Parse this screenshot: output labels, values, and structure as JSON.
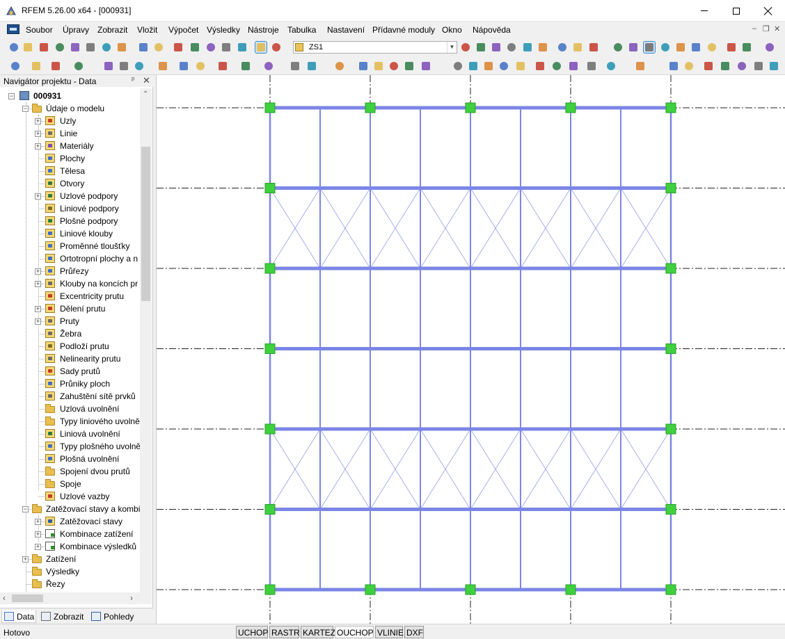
{
  "window": {
    "title": "RFEM 5.26.00 x64 - [000931]"
  },
  "menu": [
    {
      "label": "Soubor",
      "accel": "S",
      "rest": "oubor"
    },
    {
      "label": "Úpravy",
      "accel": "Ú",
      "rest": "pravy"
    },
    {
      "label": "Zobrazit",
      "accel": "Z",
      "rest": "obrazit"
    },
    {
      "label": "Vložit",
      "accel": "V",
      "rest": "ložit"
    },
    {
      "label": "Výpočet",
      "accel": "",
      "rest": "Výpočet"
    },
    {
      "label": "Výsledky",
      "accel": "",
      "rest": "Výsledky"
    },
    {
      "label": "Nástroje",
      "accel": "",
      "rest": "Nástroje"
    },
    {
      "label": "Tabulka",
      "accel": "T",
      "rest": "abulka"
    },
    {
      "label": "Nastavení",
      "accel": "",
      "rest": "Nastavení"
    },
    {
      "label": "Přídavné moduly",
      "accel": "",
      "rest": "Přídavné moduly"
    },
    {
      "label": "Okno",
      "accel": "O",
      "rest": "kno"
    },
    {
      "label": "Nápověda",
      "accel": "N",
      "rest": "ápověda"
    }
  ],
  "load_case": {
    "value": "ZS1"
  },
  "navigator": {
    "title": "Navigátor projektu - Data",
    "root": "000931",
    "tree": [
      {
        "label": "Údaje o modelu",
        "level": 1,
        "expander": "-",
        "icon": "folder"
      },
      {
        "label": "Uzly",
        "level": 2,
        "expander": "+",
        "icon": "item",
        "glyph": "#c43a2a"
      },
      {
        "label": "Linie",
        "level": 2,
        "expander": "+",
        "icon": "item",
        "glyph": "#6a6a6a"
      },
      {
        "label": "Materiály",
        "level": 2,
        "expander": "+",
        "icon": "item",
        "glyph": "#7a4ab5"
      },
      {
        "label": "Plochy",
        "level": 2,
        "expander": "",
        "icon": "item",
        "glyph": "#3e6fc4"
      },
      {
        "label": "Tělesa",
        "level": 2,
        "expander": "",
        "icon": "item",
        "glyph": "#3e6fc4"
      },
      {
        "label": "Otvory",
        "level": 2,
        "expander": "",
        "icon": "item",
        "glyph": "#2b7a45"
      },
      {
        "label": "Uzlové podpory",
        "level": 2,
        "expander": "+",
        "icon": "item",
        "glyph": "#2b7a45"
      },
      {
        "label": "Liniové podpory",
        "level": 2,
        "expander": "",
        "icon": "item",
        "glyph": "#7b6b2b"
      },
      {
        "label": "Plošné podpory",
        "level": 2,
        "expander": "",
        "icon": "item",
        "glyph": "#2b7a45"
      },
      {
        "label": "Liniové klouby",
        "level": 2,
        "expander": "",
        "icon": "item",
        "glyph": "#3e6fc4"
      },
      {
        "label": "Proměnné tloušťky",
        "level": 2,
        "expander": "",
        "icon": "item",
        "glyph": "#3e6fc4"
      },
      {
        "label": "Ortotropní plochy a n",
        "level": 2,
        "expander": "",
        "icon": "item",
        "glyph": "#3e6fc4"
      },
      {
        "label": "Průřezy",
        "level": 2,
        "expander": "+",
        "icon": "item",
        "glyph": "#3e6fc4"
      },
      {
        "label": "Klouby na koncích pr",
        "level": 2,
        "expander": "+",
        "icon": "item",
        "glyph": "#6a6a6a"
      },
      {
        "label": "Excentricity prutu",
        "level": 2,
        "expander": "",
        "icon": "item",
        "glyph": "#c43a2a"
      },
      {
        "label": "Dělení prutu",
        "level": 2,
        "expander": "+",
        "icon": "item",
        "glyph": "#c43a2a"
      },
      {
        "label": "Pruty",
        "level": 2,
        "expander": "+",
        "icon": "item",
        "glyph": "#6a6a6a"
      },
      {
        "label": "Žebra",
        "level": 2,
        "expander": "",
        "icon": "item",
        "glyph": "#6a6a6a"
      },
      {
        "label": "Podloží prutu",
        "level": 2,
        "expander": "",
        "icon": "item",
        "glyph": "#7b6b2b"
      },
      {
        "label": "Nelinearity prutu",
        "level": 2,
        "expander": "",
        "icon": "item",
        "glyph": "#6a6a6a"
      },
      {
        "label": "Sady prutů",
        "level": 2,
        "expander": "",
        "icon": "item",
        "glyph": "#c43a2a"
      },
      {
        "label": "Průniky ploch",
        "level": 2,
        "expander": "",
        "icon": "item",
        "glyph": "#3e6fc4"
      },
      {
        "label": "Zahuštění sítě prvků",
        "level": 2,
        "expander": "",
        "icon": "item",
        "glyph": "#6a6a6a"
      },
      {
        "label": "Uzlová uvolnění",
        "level": 2,
        "expander": "",
        "icon": "folder"
      },
      {
        "label": "Typy liniového uvolně",
        "level": 2,
        "expander": "",
        "icon": "folder"
      },
      {
        "label": "Liniová uvolnění",
        "level": 2,
        "expander": "",
        "icon": "item",
        "glyph": "#2b7a45"
      },
      {
        "label": "Typy plošného uvolně",
        "level": 2,
        "expander": "",
        "icon": "item",
        "glyph": "#3e6fc4"
      },
      {
        "label": "Plošná uvolnění",
        "level": 2,
        "expander": "",
        "icon": "item",
        "glyph": "#3e6fc4"
      },
      {
        "label": "Spojení dvou prutů",
        "level": 2,
        "expander": "",
        "icon": "folder"
      },
      {
        "label": "Spoje",
        "level": 2,
        "expander": "",
        "icon": "folder"
      },
      {
        "label": "Uzlové vazby",
        "level": 2,
        "expander": "",
        "icon": "item",
        "glyph": "#c43a2a"
      },
      {
        "label": "Zatěžovací stavy a kombi",
        "level": 1,
        "expander": "-",
        "icon": "folder"
      },
      {
        "label": "Zatěžovací stavy",
        "level": 2,
        "expander": "+",
        "icon": "item",
        "glyph": "#2b5fa8"
      },
      {
        "label": "Kombinace zatížení",
        "level": 2,
        "expander": "+",
        "icon": "combo"
      },
      {
        "label": "Kombinace výsledků",
        "level": 2,
        "expander": "+",
        "icon": "combo"
      },
      {
        "label": "Zatížení",
        "level": 1,
        "expander": "+",
        "icon": "folder"
      },
      {
        "label": "Výsledky",
        "level": 1,
        "expander": "",
        "icon": "folder"
      },
      {
        "label": "Řezy",
        "level": 1,
        "expander": "",
        "icon": "folder"
      }
    ],
    "tabs": [
      {
        "label": "Data",
        "active": true
      },
      {
        "label": "Zobrazit",
        "active": false
      },
      {
        "label": "Pohledy",
        "active": false
      }
    ]
  },
  "status": {
    "text": "Hotovo",
    "snap_buttons": [
      {
        "label": "UCHOP",
        "pressed": false
      },
      {
        "label": "RASTR",
        "pressed": false
      },
      {
        "label": "KARTEZ",
        "pressed": false
      },
      {
        "label": "OUCHOP",
        "pressed": true
      },
      {
        "label": "VLINIE",
        "pressed": false
      },
      {
        "label": "DXF",
        "pressed": false
      }
    ]
  },
  "model": {
    "member_color": "#7b86e6",
    "support_color": "#3fcf3f",
    "grid_color": "#222222",
    "columns": 9,
    "floors": 7,
    "braced_bays": [
      [
        1,
        2
      ],
      [
        4,
        5
      ]
    ]
  }
}
